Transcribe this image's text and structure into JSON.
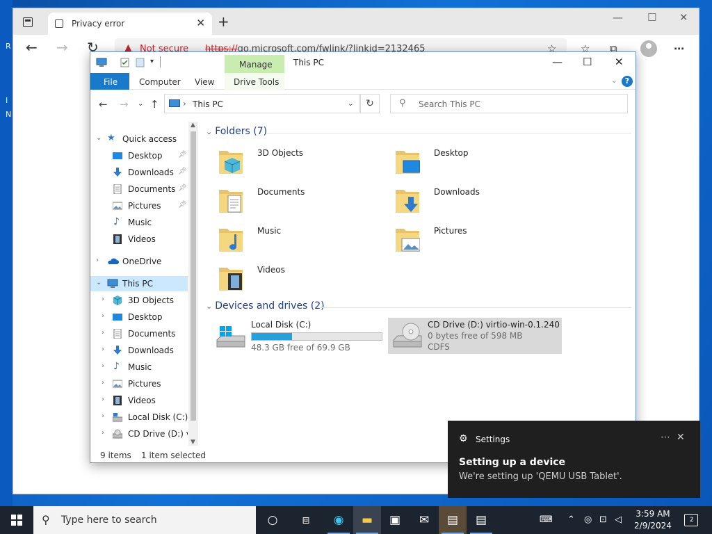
{
  "desktop": {
    "letters": [
      "R",
      "I",
      "N"
    ]
  },
  "browser": {
    "tab_title": "Privacy error",
    "address_warning": "Not secure",
    "url_scheme": "https://",
    "url_rest": "go.microsoft.com/fwlink/?linkid=2132465"
  },
  "explorer": {
    "window_title": "This PC",
    "ribbon": {
      "context_tab": "Manage",
      "file": "File",
      "computer": "Computer",
      "view": "View",
      "drive_tools": "Drive Tools"
    },
    "address": {
      "location": "This PC",
      "search_placeholder": "Search This PC"
    },
    "tree": {
      "quick_access": "Quick access",
      "quick_items": [
        "Desktop",
        "Downloads",
        "Documents",
        "Pictures",
        "Music",
        "Videos"
      ],
      "onedrive": "OneDrive",
      "this_pc": "This PC",
      "pc_items": [
        "3D Objects",
        "Desktop",
        "Documents",
        "Downloads",
        "Music",
        "Pictures",
        "Videos",
        "Local Disk (C:)",
        "CD Drive (D:) virt"
      ]
    },
    "folders_header": "Folders (7)",
    "folders": [
      "3D Objects",
      "Desktop",
      "Documents",
      "Downloads",
      "Music",
      "Pictures",
      "Videos"
    ],
    "drives_header": "Devices and drives (2)",
    "drives": [
      {
        "name": "Local Disk (C:)",
        "free": "48.3 GB free of 69.9 GB",
        "used_fraction": 0.31
      },
      {
        "name": "CD Drive (D:) virtio-win-0.1.240",
        "free": "0 bytes free of 598 MB",
        "fs": "CDFS"
      }
    ],
    "status": {
      "count": "9 items",
      "selected": "1 item selected"
    }
  },
  "toast": {
    "app": "Settings",
    "title": "Setting up a device",
    "body": "We're setting up 'QEMU USB Tablet'."
  },
  "taskbar": {
    "search_placeholder": "Type here to search",
    "time": "3:59 AM",
    "date": "2/9/2024",
    "notification_count": "2"
  },
  "colors": {
    "accent": "#1979ca",
    "selection": "#cce8ff",
    "manage_tab": "#c9ecb0",
    "toast_bg": "#1f1f1f",
    "taskbar_bg": "#1c2430"
  }
}
